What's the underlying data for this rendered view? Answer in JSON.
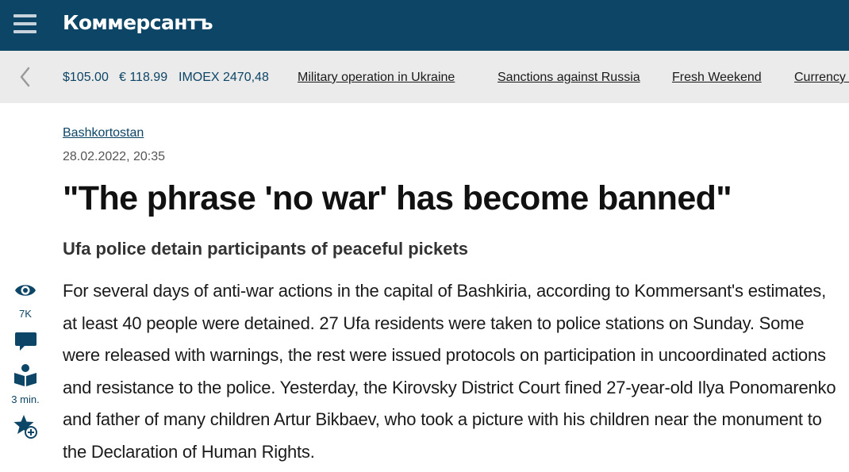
{
  "header": {
    "logo": "Коммерсантъ",
    "menu_icon": "hamburger-menu-icon"
  },
  "ticker": {
    "prev_icon": "chevron-left-icon",
    "rates": {
      "usd": "$105.00",
      "eur": "€ 118.99",
      "imoex": "IMOEX 2470,48"
    },
    "links": [
      "Military operation in Ukraine",
      "Sanctions against Russia",
      "Fresh Weekend",
      "Currency t"
    ]
  },
  "rail": {
    "views_icon": "eye-icon",
    "views": "7K",
    "comments_icon": "comment-icon",
    "read_icon": "open-book-icon",
    "read_time": "3 min.",
    "favorite_icon": "star-add-icon"
  },
  "article": {
    "rubric": "Bashkortostan",
    "date": "28.02.2022, 20:35",
    "title": "\"The phrase 'no war' has become banned\"",
    "subtitle": "Ufa police detain participants of peaceful pickets",
    "body": "For several days of anti-war actions in the capital of Bashkiria, according to Kommersant's estimates, at least 40 people were detained. 27 Ufa residents were taken to police stations on Sunday. Some were released with warnings, the rest were issued protocols on participation in uncoordinated actions and resistance to the police. Yesterday, the Kirovsky District Court fined 27-year-old Ilya Ponomarenko and father of many children Artur Bikbaev, who took a picture with his children near the monument to the Declaration of Human Rights."
  },
  "colors": {
    "brand": "#0d4566",
    "ticker_bg": "#ebebeb",
    "text": "#1a1a1a"
  }
}
